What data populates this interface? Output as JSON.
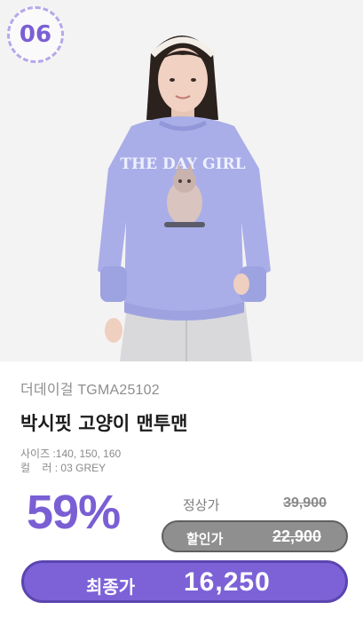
{
  "badge": {
    "number": "06"
  },
  "product": {
    "brand_code": "더데이걸 TGMA25102",
    "name": "박시핏 고양이 맨투맨",
    "size_label": "사이즈 : ",
    "sizes": "140, 150, 160",
    "color_label": "컬    러 : ",
    "color": "03 GREY",
    "print_text": "THE DAY GIRL"
  },
  "pricing": {
    "discount": "59%",
    "regular_label": "정상가",
    "regular_price": "39,900",
    "sale_label": "할인가",
    "sale_price": "22,900",
    "final_label": "최종가",
    "final_price": "16,250"
  },
  "colors": {
    "accent": "#7c62d6",
    "sweatshirt": "#a9aee8",
    "pill_grey": "#8f8f8f"
  },
  "icons": [
    "model-photo"
  ]
}
